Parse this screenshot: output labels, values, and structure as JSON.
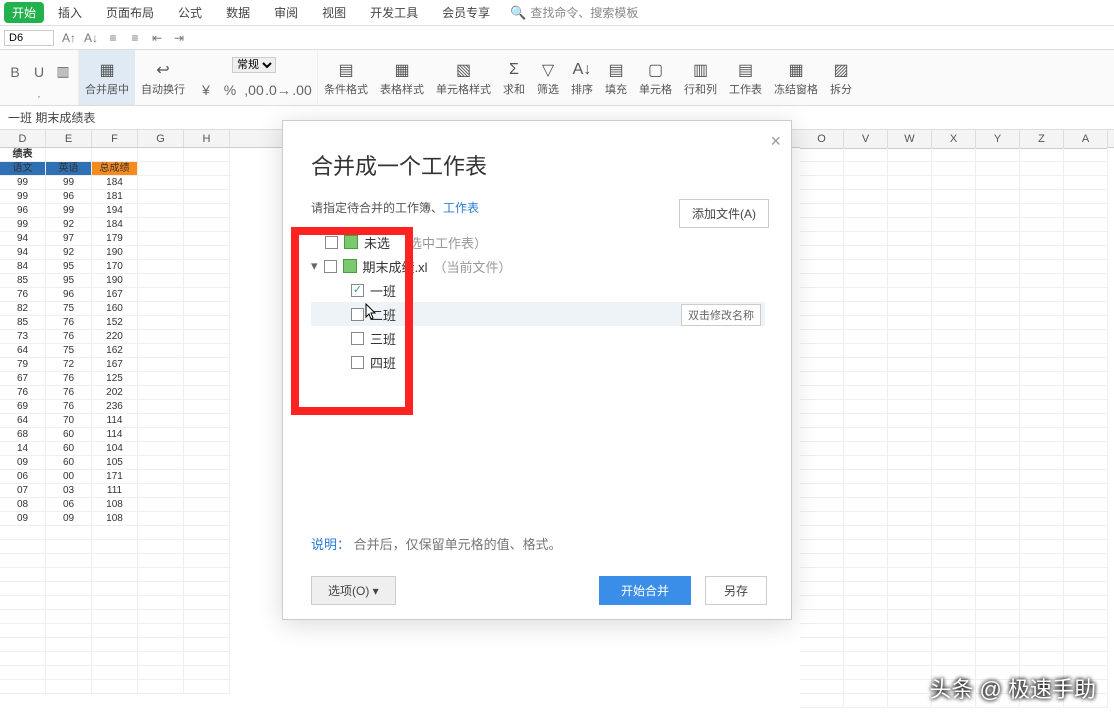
{
  "menu": {
    "start": "开始",
    "tabs": [
      "插入",
      "页面布局",
      "公式",
      "数据",
      "审阅",
      "视图",
      "开发工具",
      "会员专享"
    ],
    "search_placeholder": "查找命令、搜索模板"
  },
  "namebox": "D6",
  "ribbon": {
    "merge": "合并居中",
    "wrap": "自动换行",
    "numfmt": "常规",
    "condfmt": "条件格式",
    "tblstyle": "表格样式",
    "cellstyle": "单元格样式",
    "sum": "求和",
    "filter": "筛选",
    "sort": "排序",
    "fill": "填充",
    "cell": "单元格",
    "rowcol": "行和列",
    "sheet": "工作表",
    "freeze": "冻结窗格",
    "split": "拆分"
  },
  "sheet_path": "一班  期末成绩表",
  "grid": {
    "cols_left": [
      "D",
      "E",
      "F",
      "G",
      "H"
    ],
    "cols_right": [
      "O",
      "V",
      "W",
      "X",
      "Y",
      "Z",
      "A"
    ],
    "title_cell": "绩表",
    "hdr1": "语文",
    "hdr2": "英语",
    "hdr3": "总成绩",
    "rows": [
      [
        "99",
        "99",
        "184"
      ],
      [
        "99",
        "96",
        "181"
      ],
      [
        "96",
        "99",
        "194"
      ],
      [
        "99",
        "92",
        "184"
      ],
      [
        "94",
        "97",
        "179"
      ],
      [
        "94",
        "92",
        "190"
      ],
      [
        "84",
        "95",
        "170"
      ],
      [
        "85",
        "95",
        "190"
      ],
      [
        "76",
        "96",
        "167"
      ],
      [
        "82",
        "75",
        "160"
      ],
      [
        "85",
        "76",
        "152"
      ],
      [
        "73",
        "76",
        "220"
      ],
      [
        "64",
        "75",
        "162"
      ],
      [
        "79",
        "72",
        "167"
      ],
      [
        "67",
        "76",
        "125"
      ],
      [
        "76",
        "76",
        "202"
      ],
      [
        "69",
        "76",
        "236"
      ],
      [
        "64",
        "70",
        "114"
      ],
      [
        "68",
        "60",
        "114"
      ],
      [
        "14",
        "60",
        "104"
      ],
      [
        "09",
        "60",
        "105"
      ],
      [
        "06",
        "00",
        "171"
      ],
      [
        "07",
        "03",
        "111"
      ],
      [
        "08",
        "06",
        "108"
      ],
      [
        "09",
        "09",
        "108"
      ]
    ]
  },
  "dialog": {
    "title": "合并成一个工作表",
    "sub_a": "请指定待合并的工作簿、",
    "sub_link": "工作表",
    "add_btn": "添加文件(A)",
    "tree": {
      "self_label": "未选",
      "self_hint": "（选中工作表）",
      "file_label": "期末成绩.xl",
      "file_hint": "（当前文件）",
      "sheets": [
        "一班",
        "二班",
        "三班",
        "四班"
      ]
    },
    "sel_hint": "双击修改名称",
    "note_a": "说明：",
    "note_b": "合并后，仅保留单元格的值、格式。",
    "opt_btn": "选项(O)",
    "main_btn": "开始合并",
    "save_btn": "另存"
  },
  "watermark": "头条 @ 极速手助"
}
